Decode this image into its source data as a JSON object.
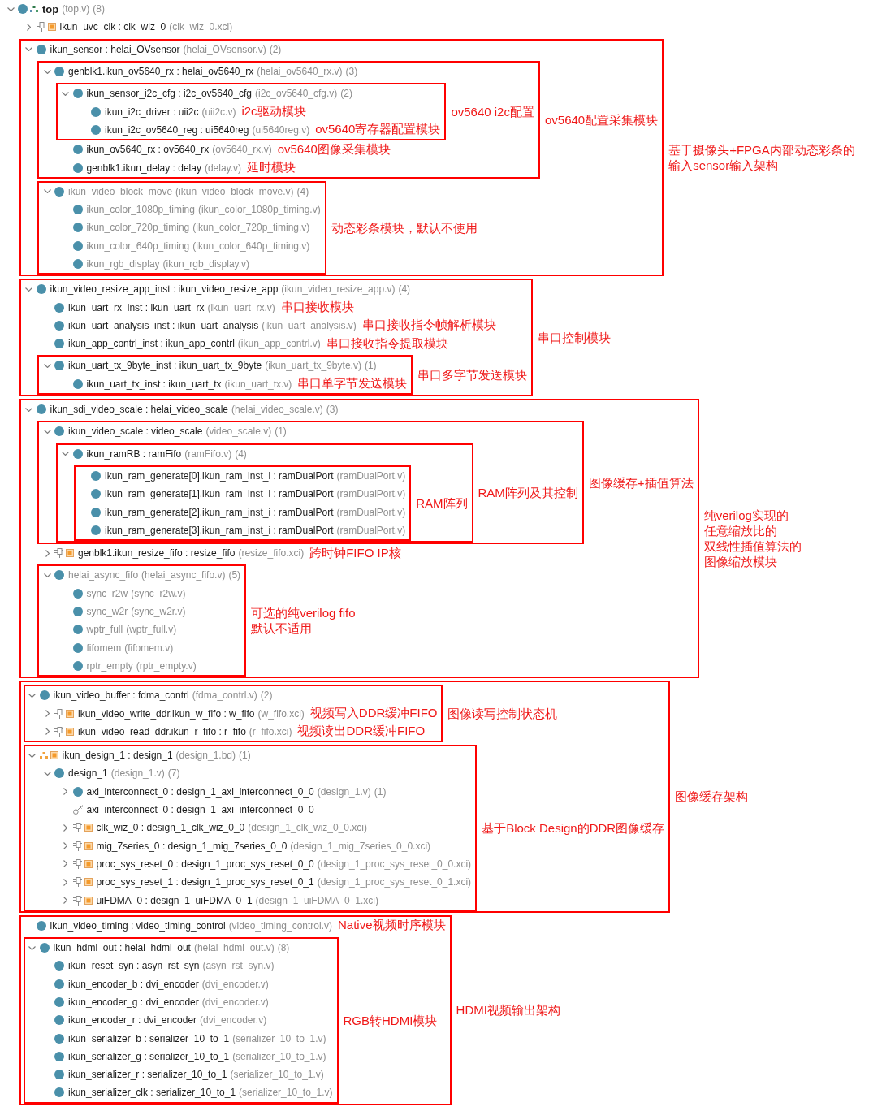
{
  "tree": [
    {
      "kind": "top",
      "name": "top",
      "source": "(top.v)",
      "count": "(8)",
      "expanded": true,
      "disabled": false,
      "children": [
        {
          "kind": "ip",
          "name": "ikun_uvc_clk : clk_wiz_0",
          "source": "(clk_wiz_0.xci)",
          "expanded": false,
          "disabled": false
        },
        {
          "kind": "frame",
          "label": [
            "基于摄像头+FPGA内部动态彩条的",
            "输入sensor输入架构"
          ],
          "items": [
            {
              "kind": "module",
              "name": "ikun_sensor : helai_OVsensor",
              "source": "(helai_OVsensor.v)",
              "count": "(2)",
              "expanded": true,
              "disabled": false,
              "children": [
                {
                  "kind": "frame",
                  "label": "ov5640配置采集模块",
                  "items": [
                    {
                      "kind": "module",
                      "name": "genblk1.ikun_ov5640_rx : helai_ov5640_rx",
                      "source": "(helai_ov5640_rx.v)",
                      "count": "(3)",
                      "expanded": true,
                      "disabled": false,
                      "children": [
                        {
                          "kind": "frame",
                          "label": "ov5640 i2c配置",
                          "items": [
                            {
                              "kind": "module",
                              "name": "ikun_sensor_i2c_cfg : i2c_ov5640_cfg",
                              "source": "(i2c_ov5640_cfg.v)",
                              "count": "(2)",
                              "expanded": true,
                              "disabled": false,
                              "children": [
                                {
                                  "kind": "module",
                                  "name": "ikun_i2c_driver : uii2c",
                                  "source": "(uii2c.v)",
                                  "disabled": false,
                                  "note": "i2c驱动模块"
                                },
                                {
                                  "kind": "module",
                                  "name": "ikun_i2c_ov5640_reg : ui5640reg",
                                  "source": "(ui5640reg.v)",
                                  "disabled": false,
                                  "note": "ov5640寄存器配置模块"
                                }
                              ]
                            }
                          ]
                        },
                        {
                          "kind": "module",
                          "name": "ikun_ov5640_rx : ov5640_rx",
                          "source": "(ov5640_rx.v)",
                          "disabled": false,
                          "note": "ov5640图像采集模块"
                        },
                        {
                          "kind": "module",
                          "name": "genblk1.ikun_delay : delay",
                          "source": "(delay.v)",
                          "disabled": false,
                          "note": "延时模块"
                        }
                      ]
                    }
                  ]
                },
                {
                  "kind": "frame",
                  "label": "动态彩条模块，默认不使用",
                  "items": [
                    {
                      "kind": "module",
                      "name": "ikun_video_block_move",
                      "source": "(ikun_video_block_move.v)",
                      "count": "(4)",
                      "expanded": true,
                      "disabled": true,
                      "children": [
                        {
                          "kind": "module",
                          "name": "ikun_color_1080p_timing",
                          "source": "(ikun_color_1080p_timing.v)",
                          "disabled": true
                        },
                        {
                          "kind": "module",
                          "name": "ikun_color_720p_timing",
                          "source": "(ikun_color_720p_timing.v)",
                          "disabled": true
                        },
                        {
                          "kind": "module",
                          "name": "ikun_color_640p_timing",
                          "source": "(ikun_color_640p_timing.v)",
                          "disabled": true
                        },
                        {
                          "kind": "module",
                          "name": "ikun_rgb_display",
                          "source": "(ikun_rgb_display.v)",
                          "disabled": true
                        }
                      ]
                    }
                  ]
                }
              ]
            }
          ]
        },
        {
          "kind": "frame",
          "label": "串口控制模块",
          "items": [
            {
              "kind": "module",
              "name": "ikun_video_resize_app_inst : ikun_video_resize_app",
              "source": "(ikun_video_resize_app.v)",
              "count": "(4)",
              "expanded": true,
              "disabled": false,
              "children": [
                {
                  "kind": "module",
                  "name": "ikun_uart_rx_inst : ikun_uart_rx",
                  "source": "(ikun_uart_rx.v)",
                  "disabled": false,
                  "note": "串口接收模块"
                },
                {
                  "kind": "module",
                  "name": "ikun_uart_analysis_inst : ikun_uart_analysis",
                  "source": "(ikun_uart_analysis.v)",
                  "disabled": false,
                  "note": "串口接收指令帧解析模块"
                },
                {
                  "kind": "module",
                  "name": "ikun_app_contrl_inst : ikun_app_contrl",
                  "source": "(ikun_app_contrl.v)",
                  "disabled": false,
                  "note": "串口接收指令提取模块"
                },
                {
                  "kind": "frame",
                  "label": "串口多字节发送模块",
                  "items": [
                    {
                      "kind": "module",
                      "name": "ikun_uart_tx_9byte_inst : ikun_uart_tx_9byte",
                      "source": "(ikun_uart_tx_9byte.v)",
                      "count": "(1)",
                      "expanded": true,
                      "disabled": false,
                      "children": [
                        {
                          "kind": "module",
                          "name": "ikun_uart_tx_inst : ikun_uart_tx",
                          "source": "(ikun_uart_tx.v)",
                          "disabled": false,
                          "note": "串口单字节发送模块"
                        }
                      ]
                    }
                  ]
                }
              ]
            }
          ]
        },
        {
          "kind": "frame",
          "label": [
            "纯verilog实现的",
            "任意缩放比的",
            "双线性插值算法的",
            "图像缩放模块"
          ],
          "items": [
            {
              "kind": "module",
              "name": "ikun_sdi_video_scale : helai_video_scale",
              "source": "(helai_video_scale.v)",
              "count": "(3)",
              "expanded": true,
              "disabled": false,
              "children": [
                {
                  "kind": "frame",
                  "label": "图像缓存+插值算法",
                  "items": [
                    {
                      "kind": "module",
                      "name": "ikun_video_scale : video_scale",
                      "source": "(video_scale.v)",
                      "count": "(1)",
                      "expanded": true,
                      "disabled": false,
                      "children": [
                        {
                          "kind": "frame",
                          "label": "RAM阵列及其控制",
                          "items": [
                            {
                              "kind": "module",
                              "name": "ikun_ramRB : ramFifo",
                              "source": "(ramFifo.v)",
                              "count": "(4)",
                              "expanded": true,
                              "disabled": false,
                              "children": [
                                {
                                  "kind": "frame",
                                  "label": "RAM阵列",
                                  "items": [
                                    {
                                      "kind": "module",
                                      "name": "ikun_ram_generate[0].ikun_ram_inst_i : ramDualPort",
                                      "source": "(ramDualPort.v)",
                                      "disabled": false
                                    },
                                    {
                                      "kind": "module",
                                      "name": "ikun_ram_generate[1].ikun_ram_inst_i : ramDualPort",
                                      "source": "(ramDualPort.v)",
                                      "disabled": false
                                    },
                                    {
                                      "kind": "module",
                                      "name": "ikun_ram_generate[2].ikun_ram_inst_i : ramDualPort",
                                      "source": "(ramDualPort.v)",
                                      "disabled": false
                                    },
                                    {
                                      "kind": "module",
                                      "name": "ikun_ram_generate[3].ikun_ram_inst_i : ramDualPort",
                                      "source": "(ramDualPort.v)",
                                      "disabled": false
                                    }
                                  ]
                                }
                              ]
                            }
                          ]
                        }
                      ]
                    }
                  ]
                },
                {
                  "kind": "ip",
                  "name": "genblk1.ikun_resize_fifo : resize_fifo",
                  "source": "(resize_fifo.xci)",
                  "expanded": false,
                  "disabled": false,
                  "note": "跨时钟FIFO IP核"
                },
                {
                  "kind": "frame",
                  "label": [
                    "可选的纯verilog fifo",
                    "默认不适用"
                  ],
                  "items": [
                    {
                      "kind": "module",
                      "name": "helai_async_fifo",
                      "source": "(helai_async_fifo.v)",
                      "count": "(5)",
                      "expanded": true,
                      "disabled": true,
                      "children": [
                        {
                          "kind": "module",
                          "name": "sync_r2w",
                          "source": "(sync_r2w.v)",
                          "disabled": true
                        },
                        {
                          "kind": "module",
                          "name": "sync_w2r",
                          "source": "(sync_w2r.v)",
                          "disabled": true
                        },
                        {
                          "kind": "module",
                          "name": "wptr_full",
                          "source": "(wptr_full.v)",
                          "disabled": true
                        },
                        {
                          "kind": "module",
                          "name": "fifomem",
                          "source": "(fifomem.v)",
                          "disabled": true
                        },
                        {
                          "kind": "module",
                          "name": "rptr_empty",
                          "source": "(rptr_empty.v)",
                          "disabled": true
                        }
                      ]
                    }
                  ]
                }
              ]
            }
          ]
        },
        {
          "kind": "frame",
          "label": "图像缓存架构",
          "items": [
            {
              "kind": "frame",
              "label": "图像读写控制状态机",
              "items": [
                {
                  "kind": "module",
                  "name": "ikun_video_buffer : fdma_contrl",
                  "source": "(fdma_contrl.v)",
                  "count": "(2)",
                  "expanded": true,
                  "disabled": false,
                  "children": [
                    {
                      "kind": "ip",
                      "name": "ikun_video_write_ddr.ikun_w_fifo : w_fifo",
                      "source": "(w_fifo.xci)",
                      "expanded": false,
                      "disabled": false,
                      "note": "视频写入DDR缓冲FIFO"
                    },
                    {
                      "kind": "ip",
                      "name": "ikun_video_read_ddr.ikun_r_fifo : r_fifo",
                      "source": "(r_fifo.xci)",
                      "expanded": false,
                      "disabled": false,
                      "note": "视频读出DDR缓冲FIFO"
                    }
                  ]
                }
              ]
            },
            {
              "kind": "frame",
              "label": "基于Block Design的DDR图像缓存",
              "items": [
                {
                  "kind": "block_design",
                  "name": "ikun_design_1 : design_1",
                  "source": "(design_1.bd)",
                  "count": "(1)",
                  "expanded": true,
                  "disabled": false,
                  "children": [
                    {
                      "kind": "module",
                      "name": "design_1",
                      "source": "(design_1.v)",
                      "count": "(7)",
                      "expanded": true,
                      "disabled": false,
                      "children": [
                        {
                          "kind": "module",
                          "name": "axi_interconnect_0 : design_1_axi_interconnect_0_0",
                          "source": "(design_1.v)",
                          "count": "(1)",
                          "expanded": false,
                          "disabled": false
                        },
                        {
                          "kind": "key",
                          "name": "axi_interconnect_0 : design_1_axi_interconnect_0_0",
                          "disabled": false
                        },
                        {
                          "kind": "ip",
                          "name": "clk_wiz_0 : design_1_clk_wiz_0_0",
                          "source": "(design_1_clk_wiz_0_0.xci)",
                          "expanded": false,
                          "disabled": false
                        },
                        {
                          "kind": "ip",
                          "name": "mig_7series_0 : design_1_mig_7series_0_0",
                          "source": "(design_1_mig_7series_0_0.xci)",
                          "expanded": false,
                          "disabled": false
                        },
                        {
                          "kind": "ip",
                          "name": "proc_sys_reset_0 : design_1_proc_sys_reset_0_0",
                          "source": "(design_1_proc_sys_reset_0_0.xci)",
                          "expanded": false,
                          "disabled": false
                        },
                        {
                          "kind": "ip",
                          "name": "proc_sys_reset_1 : design_1_proc_sys_reset_0_1",
                          "source": "(design_1_proc_sys_reset_0_1.xci)",
                          "expanded": false,
                          "disabled": false
                        },
                        {
                          "kind": "ip",
                          "name": "uiFDMA_0 : design_1_uiFDMA_0_1",
                          "source": "(design_1_uiFDMA_0_1.xci)",
                          "expanded": false,
                          "disabled": false
                        }
                      ]
                    }
                  ]
                }
              ]
            }
          ]
        },
        {
          "kind": "frame",
          "label": "HDMI视频输出架构",
          "items": [
            {
              "kind": "module",
              "name": "ikun_video_timing : video_timing_control",
              "source": "(video_timing_control.v)",
              "disabled": false,
              "note": "Native视频时序模块"
            },
            {
              "kind": "frame",
              "label": "RGB转HDMI模块",
              "items": [
                {
                  "kind": "module",
                  "name": "ikun_hdmi_out : helai_hdmi_out",
                  "source": "(helai_hdmi_out.v)",
                  "count": "(8)",
                  "expanded": true,
                  "disabled": false,
                  "children": [
                    {
                      "kind": "module",
                      "name": "ikun_reset_syn : asyn_rst_syn",
                      "source": "(asyn_rst_syn.v)",
                      "disabled": false
                    },
                    {
                      "kind": "module",
                      "name": "ikun_encoder_b : dvi_encoder",
                      "source": "(dvi_encoder.v)",
                      "disabled": false
                    },
                    {
                      "kind": "module",
                      "name": "ikun_encoder_g : dvi_encoder",
                      "source": "(dvi_encoder.v)",
                      "disabled": false
                    },
                    {
                      "kind": "module",
                      "name": "ikun_encoder_r : dvi_encoder",
                      "source": "(dvi_encoder.v)",
                      "disabled": false
                    },
                    {
                      "kind": "module",
                      "name": "ikun_serializer_b : serializer_10_to_1",
                      "source": "(serializer_10_to_1.v)",
                      "disabled": false
                    },
                    {
                      "kind": "module",
                      "name": "ikun_serializer_g : serializer_10_to_1",
                      "source": "(serializer_10_to_1.v)",
                      "disabled": false
                    },
                    {
                      "kind": "module",
                      "name": "ikun_serializer_r : serializer_10_to_1",
                      "source": "(serializer_10_to_1.v)",
                      "disabled": false
                    },
                    {
                      "kind": "module",
                      "name": "ikun_serializer_clk : serializer_10_to_1",
                      "source": "(serializer_10_to_1.v)",
                      "disabled": false
                    }
                  ]
                }
              ]
            }
          ]
        }
      ]
    }
  ]
}
